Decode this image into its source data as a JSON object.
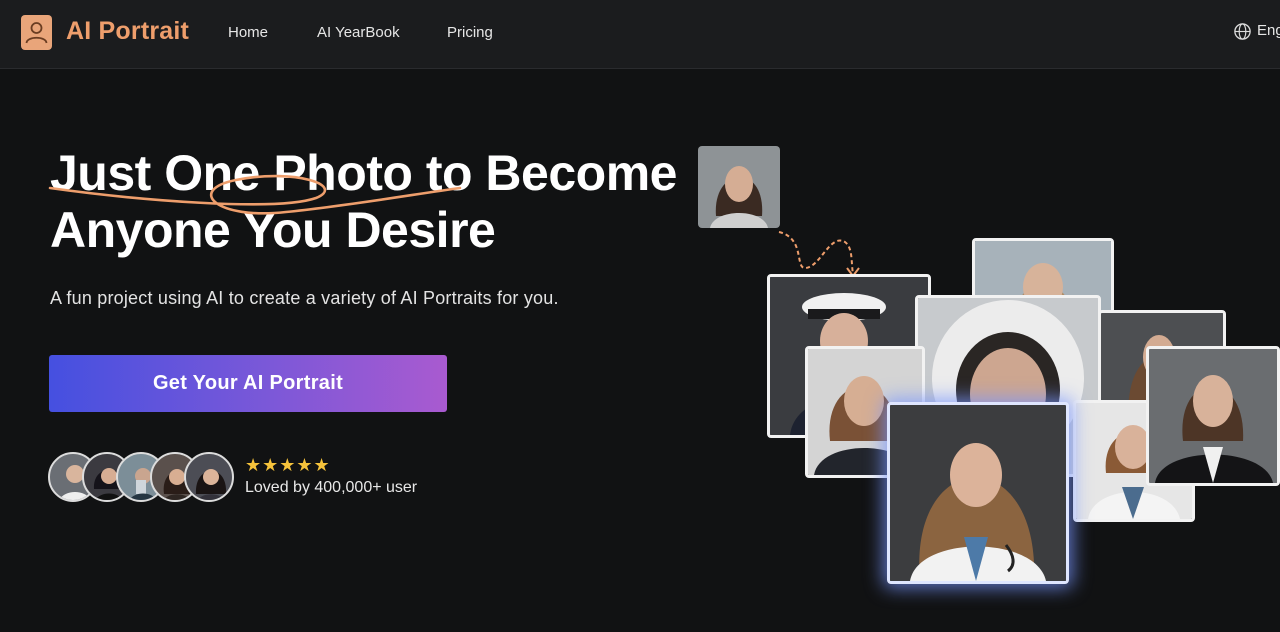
{
  "header": {
    "brand": "AI Portrait",
    "nav": [
      "Home",
      "AI YearBook",
      "Pricing"
    ],
    "language": "English"
  },
  "hero": {
    "title_line1": "Just One Photo to Become",
    "title_line2": "Anyone You Desire",
    "subtitle": "A fun project using AI to create a variety of AI Portraits for you.",
    "cta_label": "Get Your AI Portrait",
    "rating": "★★★★★",
    "social_proof": "Loved by 400,000+ user"
  },
  "colors": {
    "brand": "#ee9e6c",
    "cta_start": "#4550e0",
    "cta_end": "#a95ad0",
    "stars": "#f6c33b"
  },
  "icons": [
    "user-icon",
    "globe-icon",
    "star-icon"
  ]
}
